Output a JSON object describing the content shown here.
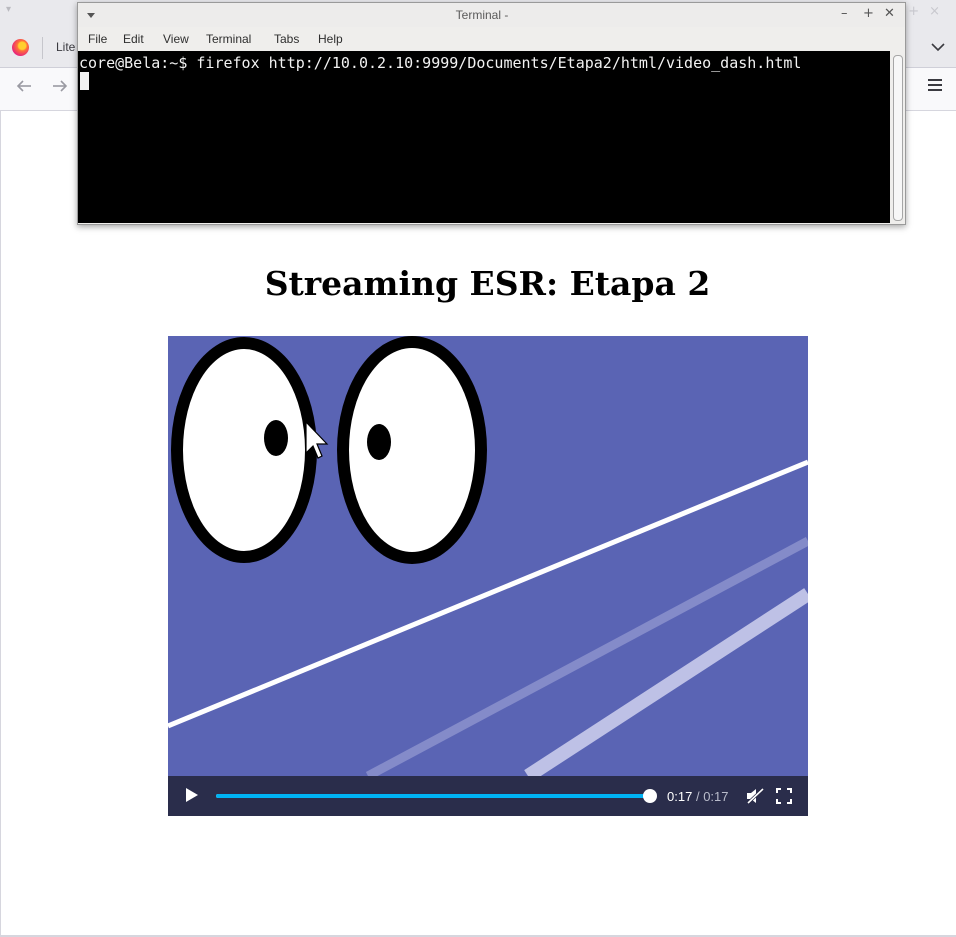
{
  "browser": {
    "tab_title": "Lite",
    "tab_list_icon": "chevron-down-icon",
    "nav_icons": [
      "back-arrow-icon",
      "forward-arrow-icon"
    ],
    "menu_icon": "hamburger-menu-icon",
    "accent_color": "#00b3f4"
  },
  "page": {
    "title": "Streaming ESR: Etapa 2"
  },
  "video": {
    "current_time": "0:17",
    "separator": "/",
    "duration": "0:17",
    "progress_fraction": 1.0,
    "muted": true,
    "playing": false,
    "background_color": "#5a64b4"
  },
  "terminal": {
    "title": "Terminal -",
    "menu": [
      "File",
      "Edit",
      "View",
      "Terminal",
      "Tabs",
      "Help"
    ],
    "controls": [
      "minimize-icon",
      "maximize-icon",
      "close-icon"
    ],
    "line1": "core@Bela:~$ firefox http://10.0.2.10:9999/Documents/Etapa2/html/video_dash.html"
  }
}
